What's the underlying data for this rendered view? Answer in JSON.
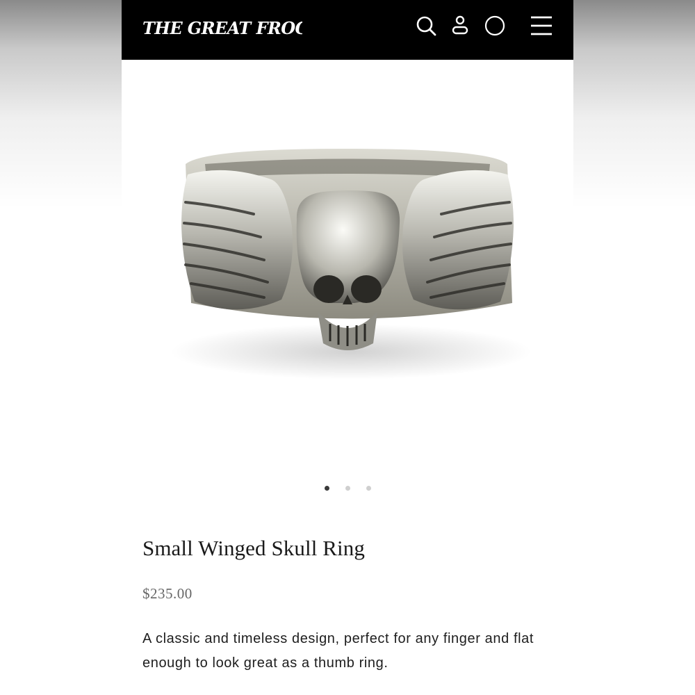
{
  "header": {
    "logo_text": "THE GREAT FROG",
    "icons": [
      "search-icon",
      "account-icon",
      "cart-icon",
      "menu-icon"
    ]
  },
  "gallery": {
    "image": "winged-skull-ring-photo",
    "slide_count": 3,
    "active_slide": 1
  },
  "product": {
    "title": "Small Winged Skull Ring",
    "price": "$235.00",
    "description": "A classic and timeless design, perfect for any finger and flat enough to look great as a thumb ring."
  },
  "colors": {
    "header_bg": "#000000",
    "header_fg": "#ffffff",
    "dot_active": "#3a3a3a",
    "dot_inactive": "#cfcfcf",
    "price": "#666666"
  }
}
